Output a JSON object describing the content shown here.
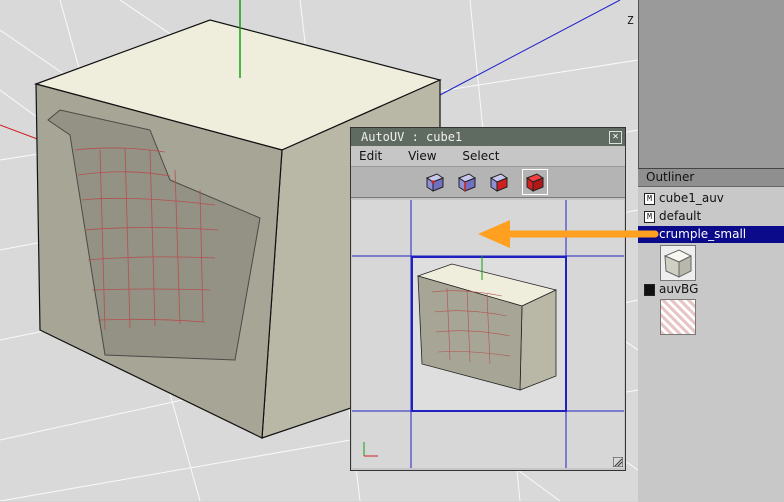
{
  "viewport": {
    "axis_label": "Z"
  },
  "autouv": {
    "title": "AutoUV : cube1",
    "close_glyph": "✕",
    "menu": [
      "Edit",
      "View",
      "Select"
    ],
    "tools": [
      {
        "name": "vertex-select-icon",
        "color": "#8f8fd8"
      },
      {
        "name": "edge-select-icon",
        "color": "#8f8fd8"
      },
      {
        "name": "face-select-icon",
        "color": "#8f8fd8"
      },
      {
        "name": "body-select-icon",
        "color": "#d02020"
      }
    ]
  },
  "outliner": {
    "title": "Outliner",
    "items": [
      {
        "tag": "M",
        "label": "cube1_auv"
      },
      {
        "tag": "M",
        "label": "default"
      },
      {
        "tag": "",
        "label": "crumple_small"
      },
      {
        "tag": "",
        "label": "auvBG"
      }
    ]
  },
  "colors": {
    "selection": "#0a0a8a",
    "arrow": "#ffa020",
    "uv_grid": "#2020c0"
  }
}
